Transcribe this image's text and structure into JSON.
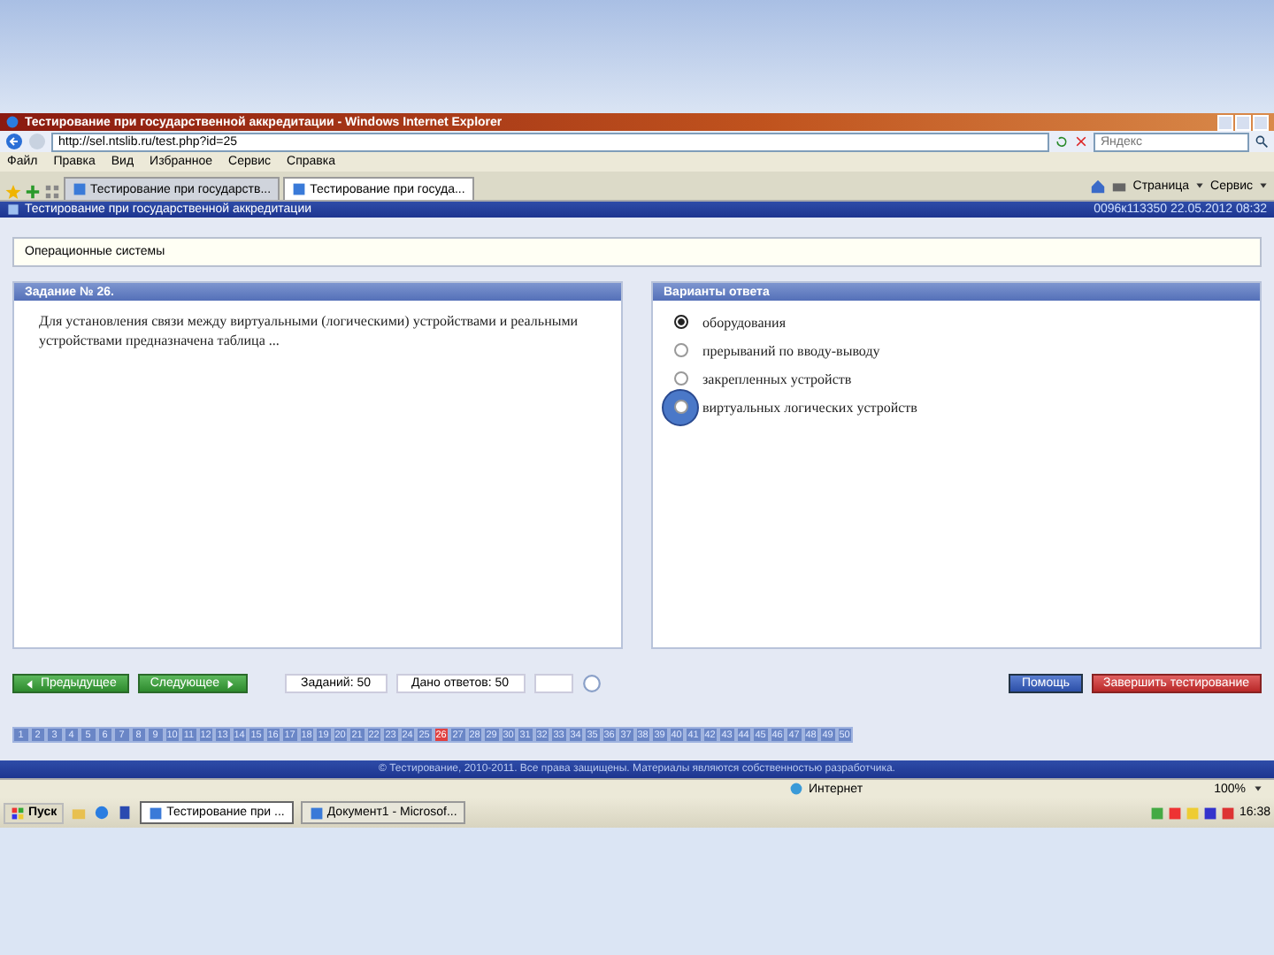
{
  "window": {
    "title": "Тестирование при государственной аккредитации - Windows Internet Explorer"
  },
  "address_bar": {
    "url": "http://sel.ntslib.ru/test.php?id=25"
  },
  "search": {
    "placeholder": "Яндекс"
  },
  "menu": [
    "Файл",
    "Правка",
    "Вид",
    "Избранное",
    "Сервис",
    "Справка"
  ],
  "tabs": [
    {
      "label": "Тестирование при государств...",
      "selected": false
    },
    {
      "label": "Тестирование при госуда...",
      "selected": true
    }
  ],
  "toolbar": [
    "Страница",
    "Сервис"
  ],
  "page_header": {
    "title": "Тестирование при государственной аккредитации",
    "session": "0096к113350 22.05.2012 08:32"
  },
  "subject": "Операционные системы",
  "task": {
    "header": "Задание № 26.",
    "text": "Для установления связи между виртуальными (логическими) устройствами и реальными устройствами предназначена таблица ..."
  },
  "answers": {
    "header": "Варианты ответа",
    "options": [
      {
        "label": "оборудования",
        "selected": true,
        "highlighted": false
      },
      {
        "label": "прерываний по вводу-выводу",
        "selected": false,
        "highlighted": false
      },
      {
        "label": "закрепленных устройств",
        "selected": false,
        "highlighted": false
      },
      {
        "label": "виртуальных логических устройств",
        "selected": false,
        "highlighted": true
      }
    ]
  },
  "nav": {
    "prev": "Предыдущее",
    "next": "Следующее",
    "total": "Заданий: 50",
    "answered": "Дано ответов: 50",
    "help": "Помощь",
    "finish": "Завершить тестирование"
  },
  "questions": [
    {
      "label": "1",
      "current": false
    },
    {
      "label": "2",
      "current": false
    },
    {
      "label": "3",
      "current": false
    },
    {
      "label": "4",
      "current": false
    },
    {
      "label": "5",
      "current": false
    },
    {
      "label": "6",
      "current": false
    },
    {
      "label": "7",
      "current": false
    },
    {
      "label": "8",
      "current": false
    },
    {
      "label": "9",
      "current": false
    },
    {
      "label": "10",
      "current": false
    },
    {
      "label": "11",
      "current": false
    },
    {
      "label": "12",
      "current": false
    },
    {
      "label": "13",
      "current": false
    },
    {
      "label": "14",
      "current": false
    },
    {
      "label": "15",
      "current": false
    },
    {
      "label": "16",
      "current": false
    },
    {
      "label": "17",
      "current": false
    },
    {
      "label": "18",
      "current": false
    },
    {
      "label": "19",
      "current": false
    },
    {
      "label": "20",
      "current": false
    },
    {
      "label": "21",
      "current": false
    },
    {
      "label": "22",
      "current": false
    },
    {
      "label": "23",
      "current": false
    },
    {
      "label": "24",
      "current": false
    },
    {
      "label": "25",
      "current": false
    },
    {
      "label": "26",
      "current": true
    },
    {
      "label": "27",
      "current": false
    },
    {
      "label": "28",
      "current": false
    },
    {
      "label": "29",
      "current": false
    },
    {
      "label": "30",
      "current": false
    },
    {
      "label": "31",
      "current": false
    },
    {
      "label": "32",
      "current": false
    },
    {
      "label": "33",
      "current": false
    },
    {
      "label": "34",
      "current": false
    },
    {
      "label": "35",
      "current": false
    },
    {
      "label": "36",
      "current": false
    },
    {
      "label": "37",
      "current": false
    },
    {
      "label": "38",
      "current": false
    },
    {
      "label": "39",
      "current": false
    },
    {
      "label": "40",
      "current": false
    },
    {
      "label": "41",
      "current": false
    },
    {
      "label": "42",
      "current": false
    },
    {
      "label": "43",
      "current": false
    },
    {
      "label": "44",
      "current": false
    },
    {
      "label": "45",
      "current": false
    },
    {
      "label": "46",
      "current": false
    },
    {
      "label": "47",
      "current": false
    },
    {
      "label": "48",
      "current": false
    },
    {
      "label": "49",
      "current": false
    },
    {
      "label": "50",
      "current": false
    }
  ],
  "footer": "© Тестирование, 2010-2011. Все права защищены. Материалы являются собственностью разработчика.",
  "status_bar": {
    "zone": "Интернет",
    "zoom": "100%"
  },
  "taskbar": {
    "start": "Пуск",
    "items": [
      {
        "label": "Тестирование при ...",
        "selected": true
      },
      {
        "label": "Документ1 - Microsof...",
        "selected": false
      }
    ],
    "clock": "16:38"
  }
}
